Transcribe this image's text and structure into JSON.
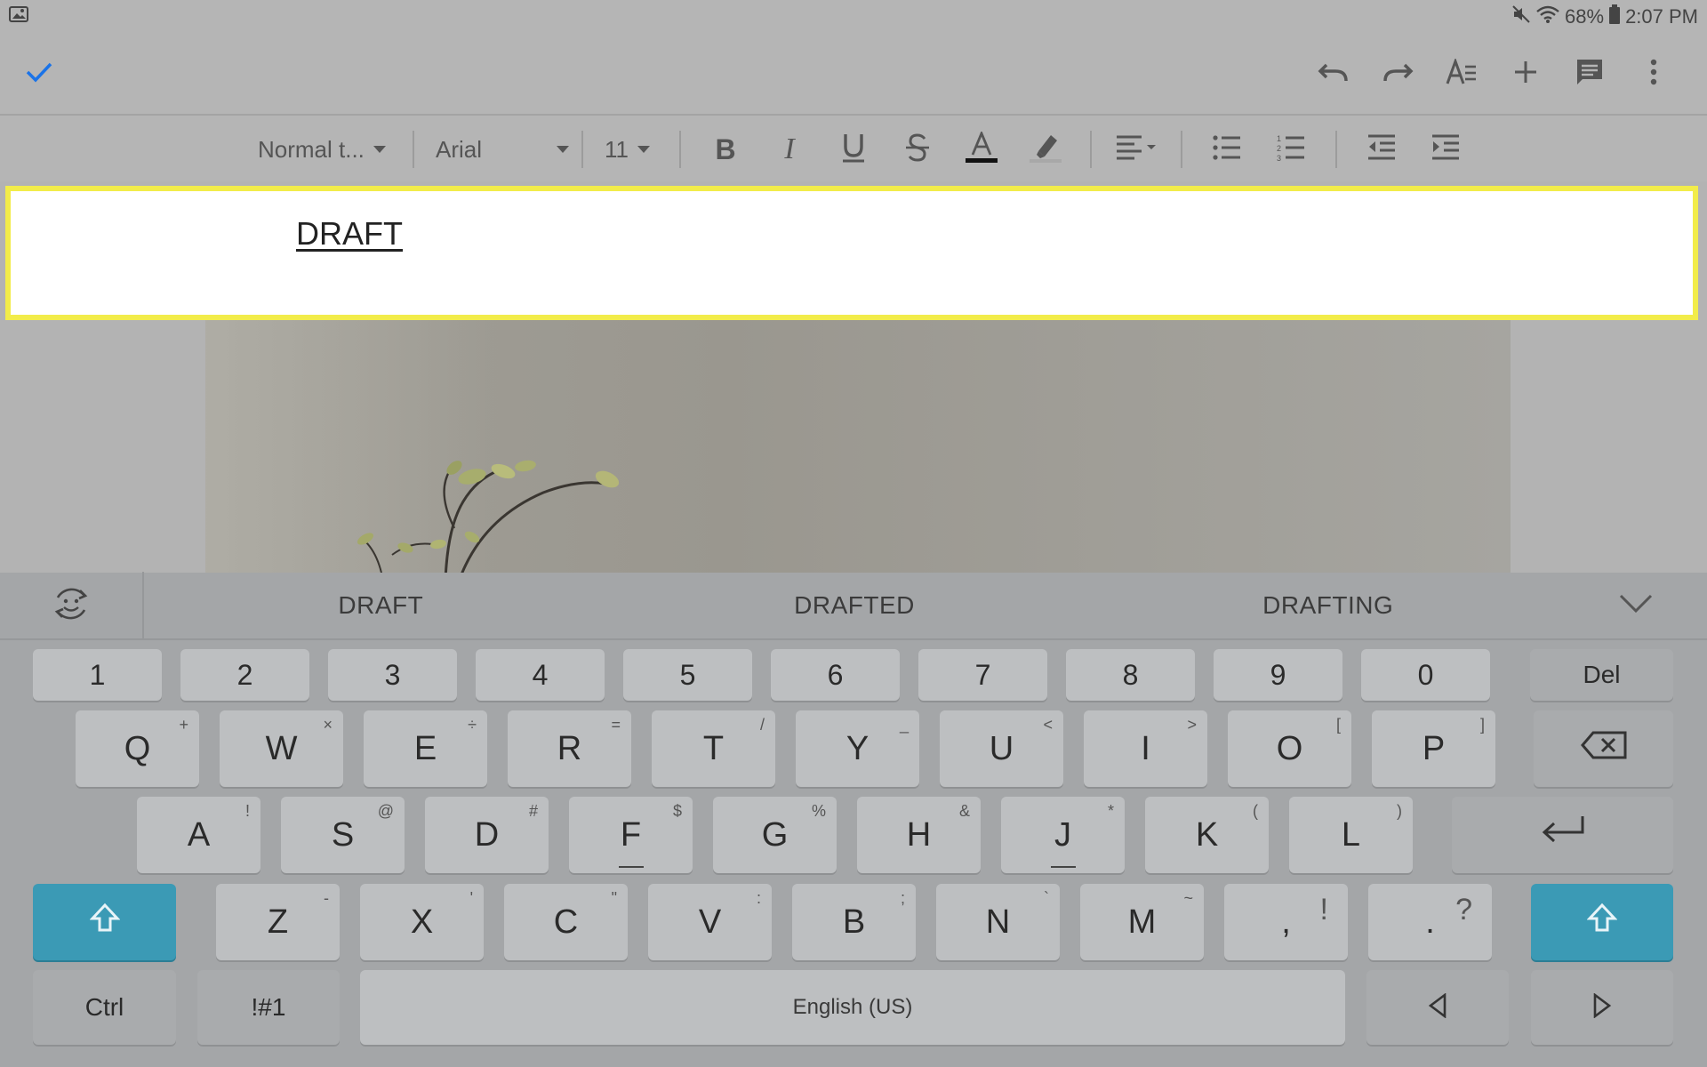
{
  "status_bar": {
    "battery": "68%",
    "time": "2:07 PM",
    "icons": [
      "image-icon",
      "mute-icon",
      "wifi-icon",
      "battery-icon"
    ]
  },
  "app_bar": {
    "done_icon": "check-icon",
    "actions": [
      "undo-icon",
      "redo-icon",
      "text-format-icon",
      "insert-icon",
      "comment-icon",
      "more-icon"
    ],
    "accent": "#1a73e8"
  },
  "format_toolbar": {
    "style": "Normal t...",
    "font": "Arial",
    "size": "11",
    "tools": [
      "bold-icon",
      "italic-icon",
      "underline-icon",
      "strikethrough-icon",
      "text-color-icon",
      "highlight-icon",
      "align-icon",
      "bullet-list-icon",
      "numbered-list-icon",
      "decrease-indent-icon",
      "increase-indent-icon"
    ]
  },
  "document": {
    "text": "DRAFT",
    "highlight_color": "#f2ec4a"
  },
  "keyboard": {
    "suggestions": [
      "DRAFT",
      "DRAFTED",
      "DRAFTING"
    ],
    "number_row": [
      "1",
      "2",
      "3",
      "4",
      "5",
      "6",
      "7",
      "8",
      "9",
      "0"
    ],
    "del_label": "Del",
    "row1": [
      {
        "k": "Q",
        "a": "+"
      },
      {
        "k": "W",
        "a": "×"
      },
      {
        "k": "E",
        "a": "÷"
      },
      {
        "k": "R",
        "a": "="
      },
      {
        "k": "T",
        "a": "/"
      },
      {
        "k": "Y",
        "a": "_"
      },
      {
        "k": "U",
        "a": "<"
      },
      {
        "k": "I",
        "a": ">"
      },
      {
        "k": "O",
        "a": "["
      },
      {
        "k": "P",
        "a": "]"
      }
    ],
    "row2": [
      {
        "k": "A",
        "a": "!"
      },
      {
        "k": "S",
        "a": "@"
      },
      {
        "k": "D",
        "a": "#"
      },
      {
        "k": "F",
        "a": "$"
      },
      {
        "k": "G",
        "a": "%"
      },
      {
        "k": "H",
        "a": "&"
      },
      {
        "k": "J",
        "a": "*"
      },
      {
        "k": "K",
        "a": "("
      },
      {
        "k": "L",
        "a": ")"
      }
    ],
    "row3": [
      {
        "k": "Z",
        "a": "-"
      },
      {
        "k": "X",
        "a": "'"
      },
      {
        "k": "C",
        "a": "\""
      },
      {
        "k": "V",
        "a": ":"
      },
      {
        "k": "B",
        "a": ";"
      },
      {
        "k": "N",
        "a": "`"
      },
      {
        "k": "M",
        "a": "~"
      },
      {
        "k": ",",
        "a": "!"
      },
      {
        "k": ".",
        "a": "?"
      }
    ],
    "ctrl_label": "Ctrl",
    "symbols_label": "!#1",
    "space_label": "English (US)",
    "shift_color": "#3b9ab5"
  }
}
